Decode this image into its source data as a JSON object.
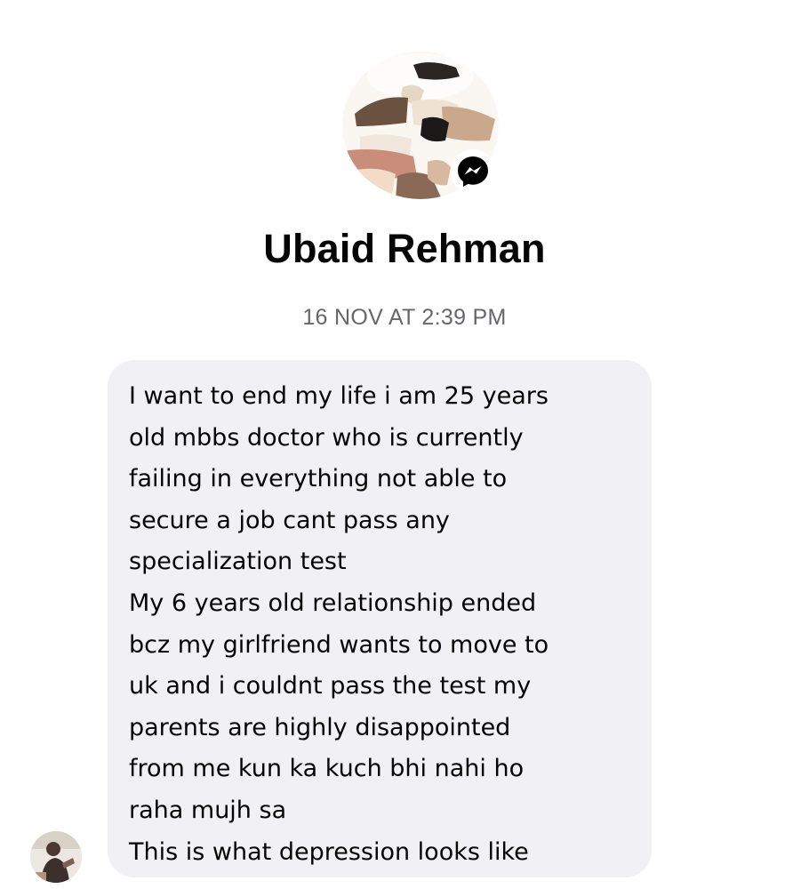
{
  "contact": {
    "name": "Ubaid Rehman",
    "photo_icon": "profile-photo",
    "badge_icon": "messenger-icon"
  },
  "conversation": {
    "timestamp": "16 NOV AT 2:39 PM",
    "messages": [
      {
        "sender": "Ubaid Rehman",
        "avatar_icon": "sender-avatar",
        "text": "I want to end my life i am 25 years\nold mbbs doctor who is currently\nfailing in everything not able to\nsecure a job cant pass any\nspecialization test\nMy 6 years old relationship ended\nbcz my girlfriend wants to move to\nuk and i couldnt pass the test my\nparents are highly disappointed\nfrom me kun ka kuch bhi nahi ho\nraha mujh sa\nThis is what depression looks like"
      }
    ]
  },
  "colors": {
    "bubble_background": "#f0f0f5",
    "timestamp_text": "#65676b",
    "primary_text": "#050505",
    "messenger_badge": "#000000"
  }
}
